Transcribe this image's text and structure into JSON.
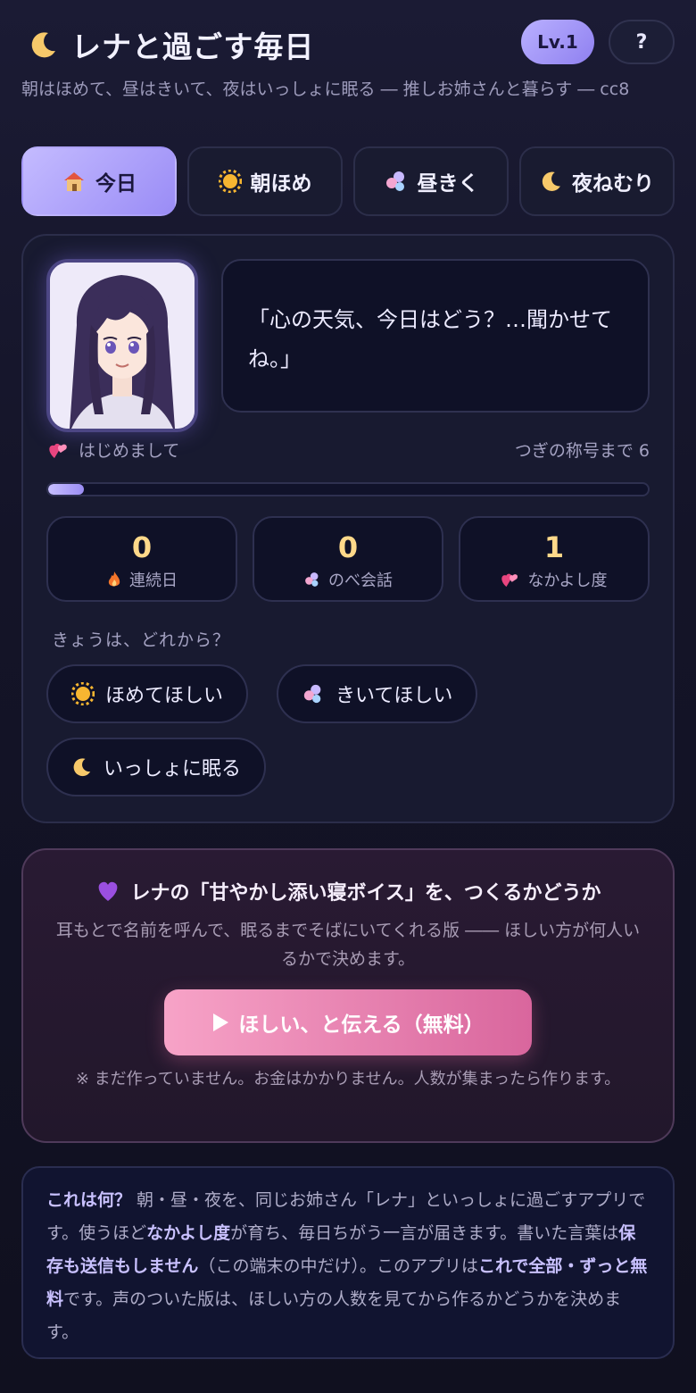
{
  "header": {
    "title": "レナと過ごす毎日",
    "level_badge": "Lv.1",
    "help_label": "?",
    "subtitle": "朝はほめて、昼はきいて、夜はいっしょに眠る ― 推しお姉さんと暮らす ― cc8"
  },
  "tabs": [
    {
      "label": "今日",
      "icon": "house-icon",
      "active": true
    },
    {
      "label": "朝ほめ",
      "icon": "sun-icon",
      "active": false
    },
    {
      "label": "昼きく",
      "icon": "bubbles-icon",
      "active": false
    },
    {
      "label": "夜ねむり",
      "icon": "moon-icon",
      "active": false
    }
  ],
  "companion": {
    "speech": "「心の天気、今日はどう？…聞かせてね。」",
    "relation_title": "はじめまして",
    "next_title_text": "つぎの称号まで 6",
    "progress": 0.06
  },
  "stats": [
    {
      "value": "0",
      "label": "連続日",
      "icon": "fire-icon"
    },
    {
      "value": "0",
      "label": "のべ会話",
      "icon": "bubbles-icon"
    },
    {
      "value": "1",
      "label": "なかよし度",
      "icon": "hearts-icon"
    }
  ],
  "choices": {
    "prompt": "きょうは、どれから？",
    "options": [
      {
        "label": "ほめてほしい",
        "icon": "sun-icon"
      },
      {
        "label": "きいてほしい",
        "icon": "bubbles-icon"
      },
      {
        "label": "いっしょに眠る",
        "icon": "moon-icon"
      }
    ]
  },
  "voice_offer": {
    "title": "レナの「甘やかし添い寝ボイス」を、つくるかどうか",
    "description": "耳もとで名前を呼んで、眠るまでそばにいてくれる版 ―― ほしい方が何人いるかで決めます。",
    "cta_label": "ほしい、と伝える（無料）",
    "cta_icon": "play-icon",
    "note": "※ まだ作っていません。お金はかかりません。人数が集まったら作ります。"
  },
  "about": {
    "q": "これは何？",
    "t1": " 朝・昼・夜を、同じお姉さん「レナ」といっしょに過ごすアプリです。使うほど",
    "b1": "なかよし度",
    "t2": "が育ち、毎日ちがう一言が届きます。書いた言葉は",
    "b2": "保存も送信もしません",
    "t3": "（この端末の中だけ）。このアプリは",
    "b3": "これで全部・ずっと無料",
    "t4": "です。声のついた版は、ほしい方の人数を見てから作るかどうかを決めます。"
  },
  "colors": {
    "accent": "#a99cf8",
    "number": "#ffd98a",
    "cta_start": "#f7a3c7",
    "cta_end": "#d9669d"
  }
}
